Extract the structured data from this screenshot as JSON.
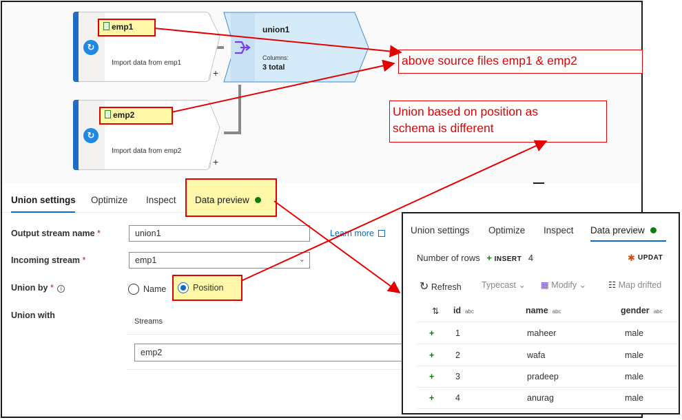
{
  "canvas": {
    "source1": {
      "name": "emp1",
      "description": "Import data from emp1"
    },
    "source2": {
      "name": "emp2",
      "description": "Import data from emp2"
    },
    "union": {
      "name": "union1",
      "columns_label": "Columns:",
      "columns_value": "3 total"
    },
    "plus_glyph": "+"
  },
  "tabs": [
    {
      "label": "Union settings"
    },
    {
      "label": "Optimize"
    },
    {
      "label": "Inspect"
    },
    {
      "label": "Data preview"
    }
  ],
  "form": {
    "output_stream_label": "Output stream name",
    "output_stream_value": "union1",
    "learn_more": "Learn more",
    "incoming_stream_label": "Incoming stream",
    "incoming_stream_value": "emp1",
    "union_by_label": "Union by",
    "union_by_options": [
      "Name",
      "Position"
    ],
    "union_by_selected": "Position",
    "union_with_label": "Union with",
    "streams_header": "Streams",
    "stream_value": "emp2",
    "required_mark": "*"
  },
  "annotations": {
    "sources": "above source files emp1 & emp2",
    "union_note_line1": "Union based on position as",
    "union_note_line2": "schema is different"
  },
  "inset": {
    "tabs": [
      "Union settings",
      "Optimize",
      "Inspect",
      "Data preview"
    ],
    "rows_label": "Number of rows",
    "insert_label": "INSERT",
    "insert_count": "4",
    "update_label": "UPDAT",
    "toolbar": {
      "refresh": "Refresh",
      "typecast": "Typecast",
      "modify": "Modify",
      "map_drifted": "Map drifted"
    },
    "columns": [
      "id",
      "name",
      "gender"
    ],
    "type_tag": "abc",
    "rows": [
      {
        "id": "1",
        "name": "maheer",
        "gender": "male"
      },
      {
        "id": "2",
        "name": "wafa",
        "gender": "male"
      },
      {
        "id": "3",
        "name": "pradeep",
        "gender": "male"
      },
      {
        "id": "4",
        "name": "anurag",
        "gender": "male"
      }
    ]
  },
  "colors": {
    "accent": "#0f6cbd",
    "annotation_red": "#e40000",
    "highlight_yellow": "#fff8a8",
    "union_fill": "#d6ebfa",
    "status_green": "#107c10"
  }
}
